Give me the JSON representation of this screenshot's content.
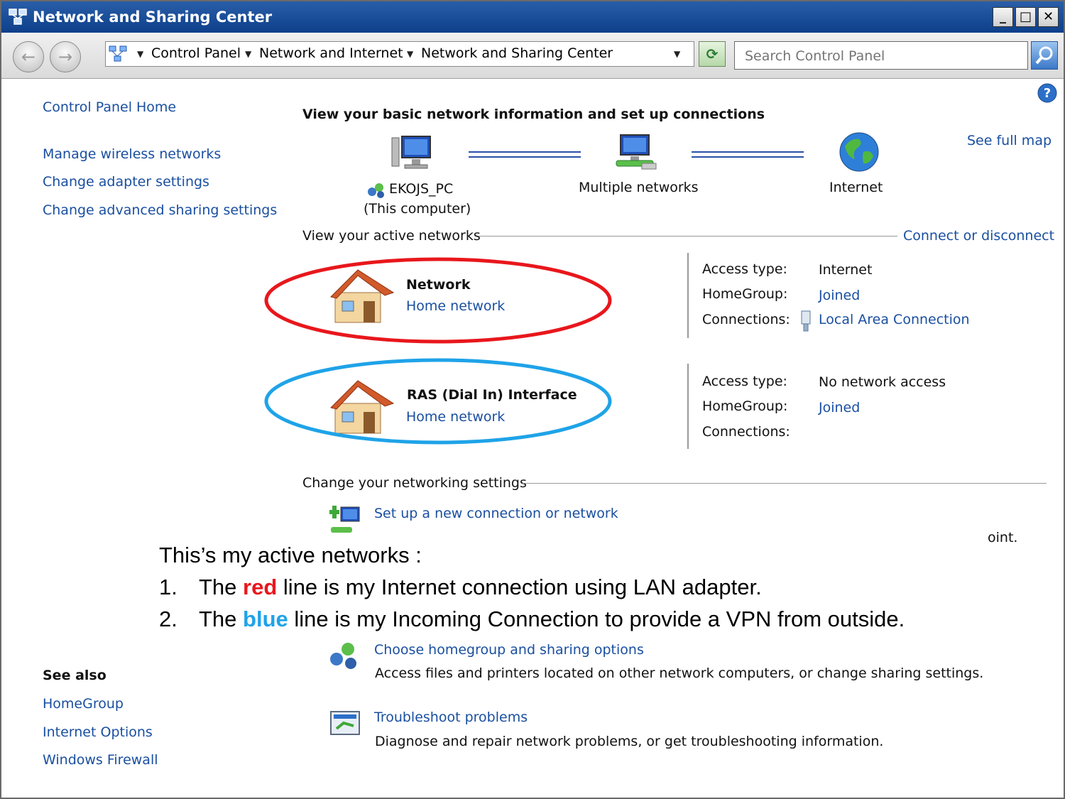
{
  "window": {
    "title": "Network and Sharing Center"
  },
  "breadcrumb": {
    "items": [
      "Control Panel",
      "Network and Internet",
      "Network and Sharing Center"
    ]
  },
  "search": {
    "placeholder": "Search Control Panel"
  },
  "sidebar": {
    "home": "Control Panel Home",
    "links": [
      "Manage wireless networks",
      "Change adapter settings",
      "Change advanced sharing settings"
    ],
    "see_also_title": "See also",
    "see_also": [
      "HomeGroup",
      "Internet Options",
      "Windows Firewall"
    ]
  },
  "main": {
    "heading": "View your basic network information and set up connections",
    "see_full_map": "See full map",
    "map": {
      "computer_name": "EKOJS_PC",
      "computer_sub": "(This computer)",
      "middle": "Multiple networks",
      "internet": "Internet"
    },
    "active_label": "View your active networks",
    "connect_link": "Connect or disconnect",
    "networks": [
      {
        "name": "Network",
        "category": "Home network",
        "access_label": "Access type:",
        "access_value": "Internet",
        "homegroup_label": "HomeGroup:",
        "homegroup_value": "Joined",
        "connections_label": "Connections:",
        "connections_value": "Local Area Connection"
      },
      {
        "name": "RAS (Dial In) Interface",
        "category": "Home network",
        "access_label": "Access type:",
        "access_value": "No network access",
        "homegroup_label": "HomeGroup:",
        "homegroup_value": "Joined",
        "connections_label": "Connections:"
      }
    ],
    "change_label": "Change your networking settings",
    "tasks": [
      {
        "title": "Set up a new connection or network"
      },
      {
        "title": "Choose homegroup and sharing options",
        "desc": "Access files and printers located on other network computers, or change sharing settings."
      },
      {
        "title": "Troubleshoot problems",
        "desc": "Diagnose and repair network problems, or get troubleshooting information."
      }
    ],
    "clipped_text": "oint."
  },
  "annotation": {
    "intro": "This’s my active networks :",
    "item1_num": "1.",
    "item1_pre": "The",
    "item1_color": "red",
    "item1_post": "line is my Internet connection using LAN adapter.",
    "item2_num": "2.",
    "item2_pre": "The",
    "item2_color": "blue",
    "item2_post": "line is my Incoming Connection to provide a VPN from outside.",
    "red_hex": "#e8171c",
    "blue_hex": "#1fa3e8"
  }
}
